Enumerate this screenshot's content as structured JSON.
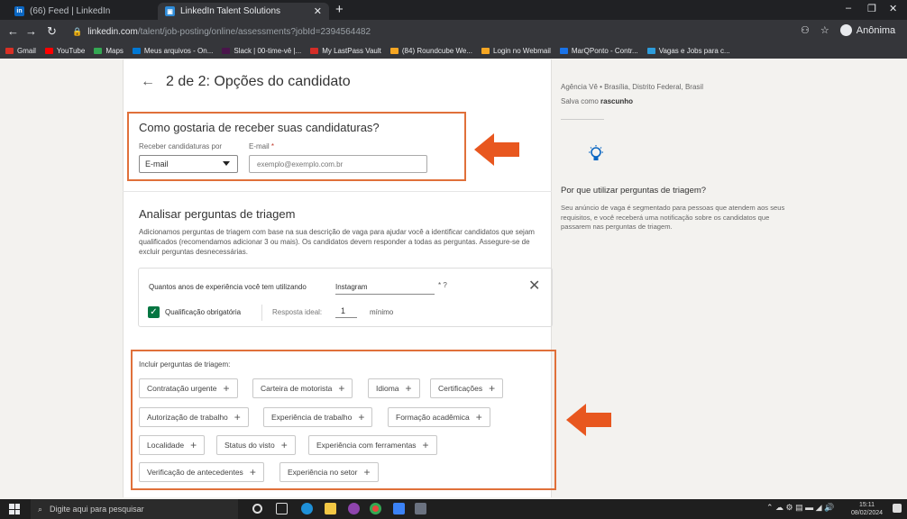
{
  "browser": {
    "tabs": [
      {
        "label": "(66) Feed | LinkedIn",
        "icon": "linkedin-icon"
      },
      {
        "label": "LinkedIn Talent Solutions",
        "icon": "linkedin-talent-icon"
      }
    ],
    "new_tab": "+",
    "url_domain": "linkedin.com",
    "url_path": "/talent/job-posting/online/assessments?jobId=2394564482",
    "profile_label": "Anônima",
    "bookmarks": [
      {
        "label": "Gmail",
        "color": "#d93025"
      },
      {
        "label": "YouTube",
        "color": "#ff0000"
      },
      {
        "label": "Maps",
        "color": "#34a853"
      },
      {
        "label": "Meus arquivos - On...",
        "color": "#0078d4"
      },
      {
        "label": "Slack | 00-time-vê |...",
        "color": "#4a154b"
      },
      {
        "label": "My LastPass Vault",
        "color": "#d32d27"
      },
      {
        "label": "(84) Roundcube We...",
        "color": "#f5a623"
      },
      {
        "label": "Login no Webmail",
        "color": "#f5a623"
      },
      {
        "label": "MarQPonto - Contr...",
        "color": "#1a73e8"
      },
      {
        "label": "Vagas e Jobs para c...",
        "color": "#2d9cdb"
      }
    ]
  },
  "page": {
    "header": "2 de 2: Opções do candidato",
    "receive_section": {
      "title": "Como gostaria de receber suas candidaturas?",
      "receive_label": "Receber candidaturas por",
      "receive_value": "E-mail",
      "email_label": "E-mail",
      "email_required": "*",
      "email_placeholder": "exemplo@exemplo.com.br"
    },
    "screening_section": {
      "title": "Analisar perguntas de triagem",
      "description": "Adicionamos perguntas de triagem com base na sua descrição de vaga para ajudar você a identificar candidatos que sejam qualificados (recomendamos adicionar 3 ou mais). Os candidatos devem responder a todas as perguntas. Assegure-se de excluir perguntas desnecessárias.",
      "question": {
        "text": "Quantos anos de experiência você tem utilizando",
        "value": "Instagram",
        "mark": "* ?",
        "close": "✕",
        "required_label": "Qualificação obrigatória",
        "ideal_label": "Resposta ideal:",
        "ideal_value": "1",
        "ideal_unit": "mínimo"
      }
    },
    "include_section": {
      "title": "Incluir perguntas de triagem:",
      "chips": [
        "Contratação urgente",
        "Carteira de motorista",
        "Idioma",
        "Certificações",
        "Autorização de trabalho",
        "Experiência de trabalho",
        "Formação acadêmica",
        "Localidade",
        "Status do visto",
        "Experiência com ferramentas",
        "Verificação de antecedentes",
        "Experiência no setor"
      ],
      "plus": "+"
    }
  },
  "sidebar": {
    "location": "Agência Vê • Brasília, Distrito Federal, Brasil",
    "saved_prefix": "Salva como",
    "saved_value": "rascunho",
    "title": "Por que utilizar perguntas de triagem?",
    "description": "Seu anúncio de vaga é segmentado para pessoas que atendem aos seus requisitos, e você receberá uma notificação sobre os candidatos que passarem nas perguntas de triagem."
  },
  "taskbar": {
    "search_placeholder": "Digite aqui para pesquisar",
    "time": "15:11",
    "date": "08/02/2024"
  },
  "colors": {
    "highlight": "#e0703a",
    "arrow": "#e8571f",
    "check": "#057642",
    "linkedin": "#0a66c2"
  }
}
